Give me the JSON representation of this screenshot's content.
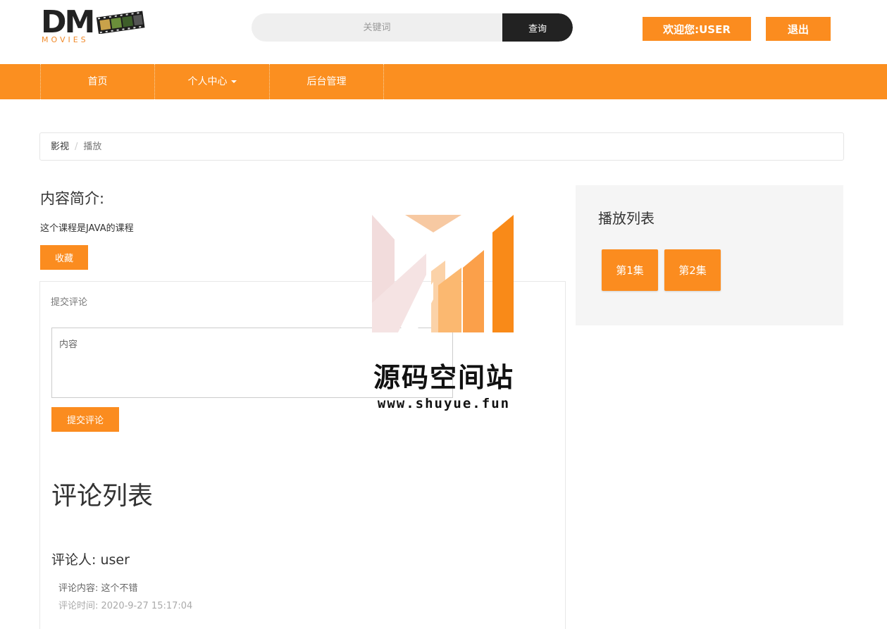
{
  "header": {
    "logo_text": "DM",
    "logo_sub": "MOVIES",
    "search_placeholder": "关键词",
    "search_button": "查询",
    "welcome": "欢迎您:USER",
    "logout": "退出"
  },
  "nav": {
    "items": [
      {
        "label": "首页"
      },
      {
        "label": "个人中心"
      },
      {
        "label": "后台管理"
      }
    ]
  },
  "breadcrumb": {
    "home": "影视",
    "separator": "/",
    "current": "播放"
  },
  "intro": {
    "title": "内容简介:",
    "description": "这个课程是JAVA的课程",
    "collect_button": "收藏"
  },
  "comment_form": {
    "heading": "提交评论",
    "textarea_placeholder": "内容",
    "submit_button": "提交评论"
  },
  "comment_list": {
    "title": "评论列表",
    "items": [
      {
        "author": "评论人:  user",
        "content": "评论内容:  这个不错",
        "time": "评论时间:  2020-9-27 15:17:04"
      }
    ]
  },
  "playlist": {
    "title": "播放列表",
    "episodes": [
      {
        "label": "第1集"
      },
      {
        "label": "第2集"
      }
    ]
  },
  "watermark": {
    "name": "源码空间站",
    "url": "www.shuyue.fun"
  },
  "colors": {
    "accent": "#fb8c1f",
    "nav": "#fb8f20",
    "dark": "#222222"
  }
}
